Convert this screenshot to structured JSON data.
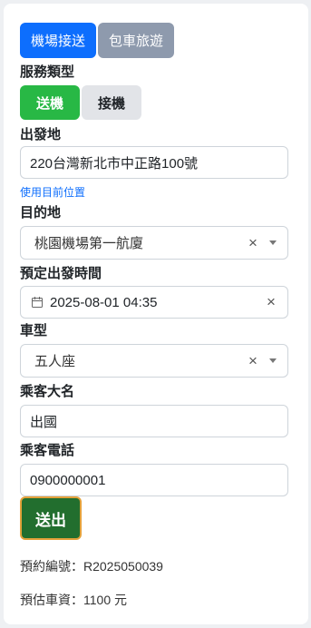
{
  "tabs": [
    {
      "label": "機場接送",
      "active": true
    },
    {
      "label": "包車旅遊",
      "active": false
    }
  ],
  "service": {
    "label": "服務類型",
    "options": [
      {
        "label": "送機",
        "active": true
      },
      {
        "label": "接機",
        "active": false
      }
    ]
  },
  "departure": {
    "label": "出發地",
    "value": "220台灣新北市中正路100號",
    "link": "使用目前位置"
  },
  "destination": {
    "label": "目的地",
    "value": "桃園機場第一航廈"
  },
  "datetime": {
    "label": "預定出發時間",
    "value": "2025-08-01 04:35"
  },
  "car_type": {
    "label": "車型",
    "value": "五人座"
  },
  "passenger_name": {
    "label": "乘客大名",
    "value": "出國"
  },
  "passenger_phone": {
    "label": "乘客電話",
    "value": "0900000001"
  },
  "submit_label": "送出",
  "result": {
    "booking": "預約編號：R2025050039",
    "fare": "預估車資：1100 元"
  },
  "colors": {
    "primary": "#0d6efd",
    "success": "#28b845",
    "submit": "#226e2e",
    "link": "#0d6efd"
  },
  "icons": {
    "clear": "close-icon",
    "dropdown": "chevron-down-icon",
    "calendar": "calendar-icon"
  }
}
